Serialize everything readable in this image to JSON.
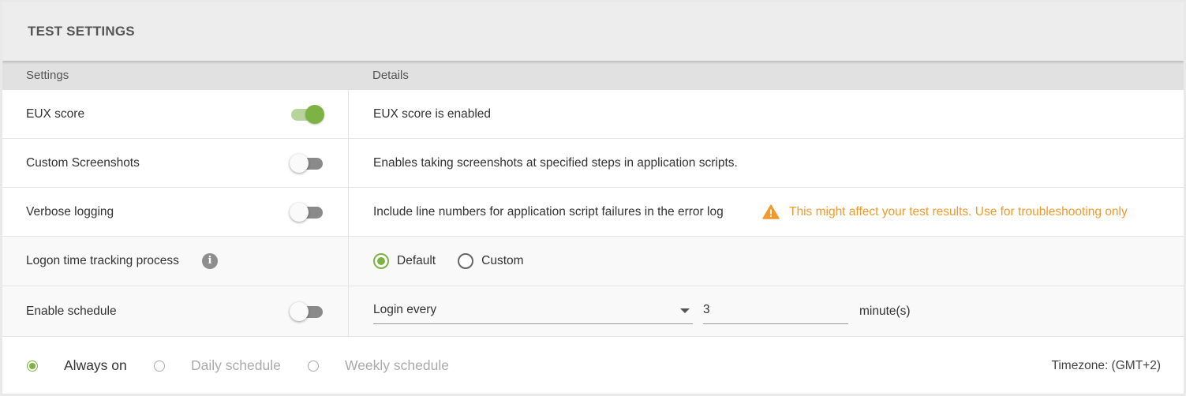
{
  "header": {
    "title": "TEST SETTINGS"
  },
  "columns": {
    "settings": "Settings",
    "details": "Details"
  },
  "rows": {
    "eux": {
      "label": "EUX score",
      "enabled": true,
      "detail": "EUX score is enabled"
    },
    "screenshots": {
      "label": "Custom Screenshots",
      "enabled": false,
      "detail": "Enables taking screenshots at specified steps in application scripts."
    },
    "verbose": {
      "label": "Verbose logging",
      "enabled": false,
      "detail": "Include line numbers for application script failures in the error log",
      "warning": "This might affect your test results. Use for troubleshooting only"
    },
    "logon": {
      "label": "Logon time tracking process",
      "info_icon": "info-icon",
      "options": [
        "Default",
        "Custom"
      ],
      "selected": "Default"
    },
    "schedule": {
      "label": "Enable schedule",
      "enabled": false,
      "interval_select": "Login every",
      "interval_value": "3",
      "unit": "minute(s)"
    }
  },
  "footer": {
    "options": [
      "Always on",
      "Daily schedule",
      "Weekly schedule"
    ],
    "selected": "Always on",
    "timezone": "Timezone: (GMT+2)"
  },
  "colors": {
    "accent": "#7db244",
    "warning": "#f2992e"
  }
}
